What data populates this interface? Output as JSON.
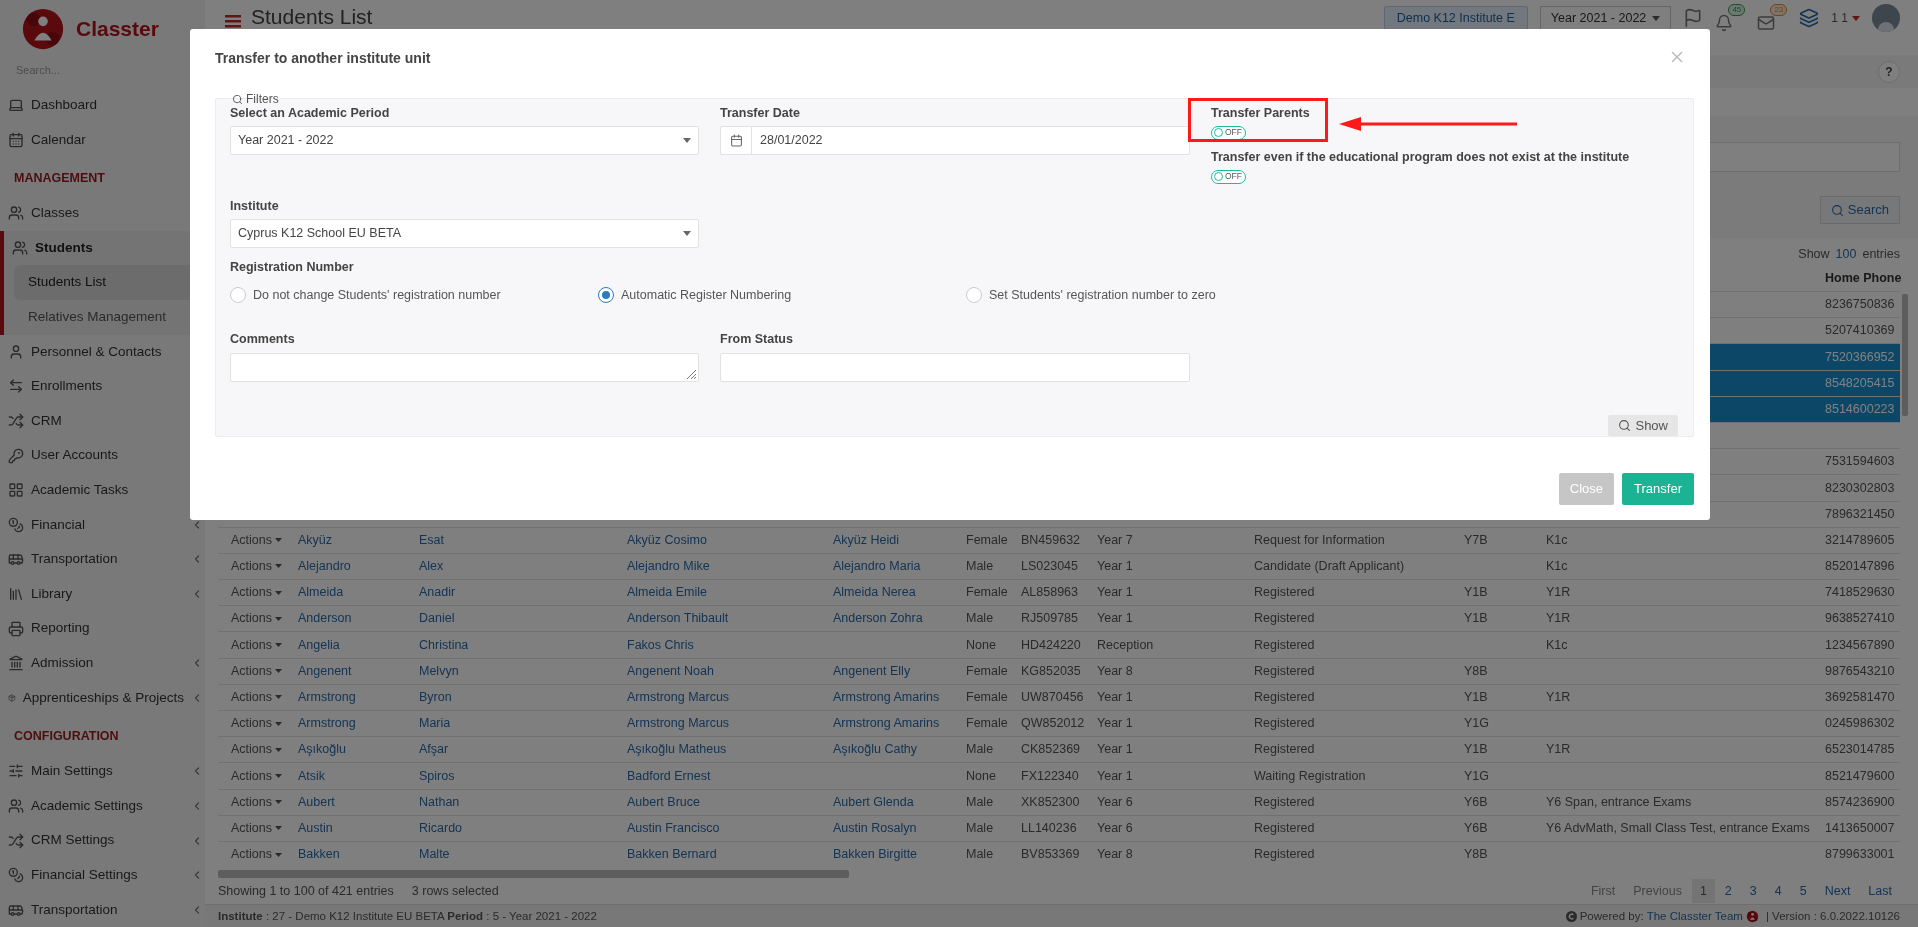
{
  "sidebar": {
    "logo": "Classter",
    "search": {
      "placeholder": "Search..."
    },
    "sections": [
      {
        "items": [
          {
            "label": "Dashboard",
            "selected": false
          },
          {
            "label": "Calendar",
            "selected": false
          }
        ]
      },
      {
        "title": "MANAGEMENT",
        "items": [
          {
            "label": "Classes",
            "selected": false
          },
          {
            "label": "Students",
            "selected": true,
            "children": [
              {
                "label": "Students List",
                "selected": true
              },
              {
                "label": "Relatives Management",
                "selected": false
              }
            ]
          },
          {
            "label": "Personnel & Contacts",
            "selected": false
          },
          {
            "label": "Enrollments",
            "selected": false
          },
          {
            "label": "CRM",
            "selected": false
          },
          {
            "label": "User Accounts",
            "selected": false
          },
          {
            "label": "Academic Tasks",
            "selected": false
          },
          {
            "label": "Financial",
            "selected": false,
            "submenu": true
          },
          {
            "label": "Transportation",
            "selected": false,
            "submenu": true
          },
          {
            "label": "Library",
            "selected": false,
            "submenu": true
          },
          {
            "label": "Reporting",
            "selected": false,
            "submenu": false
          },
          {
            "label": "Admission",
            "selected": false,
            "submenu": true
          },
          {
            "label": "Apprenticeships & Projects",
            "selected": false,
            "submenu": true
          }
        ]
      },
      {
        "title": "CONFIGURATION",
        "items": [
          {
            "label": "Main Settings",
            "selected": false,
            "submenu": true
          },
          {
            "label": "Academic Settings",
            "selected": false,
            "submenu": true
          },
          {
            "label": "CRM Settings",
            "selected": false,
            "submenu": true
          },
          {
            "label": "Financial Settings",
            "selected": false,
            "submenu": true
          },
          {
            "label": "Transportation",
            "selected": false,
            "submenu": true
          }
        ]
      }
    ]
  },
  "header": {
    "title": "Students List",
    "institute_button": "Demo K12 Institute E",
    "period_select": "Year 2021 - 2022",
    "notifications": "45",
    "messages": "23",
    "user": "1 1",
    "help": "?"
  },
  "filters": {
    "search_button": "Search"
  },
  "table": {
    "show": "Show",
    "page_size": "100",
    "entries": "entries",
    "home_phone_heading": "Home Phone",
    "rows": [
      {
        "selected": false,
        "home_phone": "8236750836"
      },
      {
        "selected": false,
        "home_phone": "5207410369"
      },
      {
        "selected": true,
        "home_phone": "7520366952"
      },
      {
        "selected": true,
        "home_phone": "8548205415"
      },
      {
        "selected": true,
        "home_phone": "8514600223"
      },
      {
        "selected": false
      },
      {
        "selected": false,
        "home_phone": "7531594603"
      },
      {
        "selected": false,
        "home_phone": "8230302803"
      },
      {
        "selected": false,
        "home_phone": "7896321450"
      },
      {
        "selected": false,
        "actions": "Actions",
        "column_2": "Akyüz",
        "column_3": "Esat",
        "column_4": "Akyüz Cosimo",
        "column_5": "Akyüz Heidi",
        "column_6": "Female",
        "column_7": "BN459632",
        "column_8": "Year 7",
        "column_9": "Request for Information",
        "column_10": "Y7B",
        "column_11": "K1c",
        "home_phone": "3214789605"
      },
      {
        "selected": false,
        "actions": "Actions",
        "column_2": "Alejandro",
        "column_3": "Alex",
        "column_4": "Alejandro Mike",
        "column_5": "Alejandro Maria",
        "column_6": "Male",
        "column_7": "LS023045",
        "column_8": "Year 1",
        "column_9": "Candidate (Draft Applicant)",
        "column_11": "K1c",
        "home_phone": "8520147896"
      },
      {
        "selected": false,
        "actions": "Actions",
        "column_2": "Almeida",
        "column_3": "Anadir",
        "column_4": "Almeida Emile",
        "column_5": "Almeida Nerea",
        "column_6": "Female",
        "column_7": "AL858963",
        "column_8": "Year 1",
        "column_9": "Registered",
        "column_10": "Y1B",
        "column_11": "Y1R",
        "home_phone": "7418529630"
      },
      {
        "selected": false,
        "actions": "Actions",
        "column_2": "Anderson",
        "column_3": "Daniel",
        "column_4": "Anderson Thibault",
        "column_5": "Anderson Zohra",
        "column_6": "Male",
        "column_7": "RJ509785",
        "column_8": "Year 1",
        "column_9": "Registered",
        "column_10": "Y1B",
        "column_11": "Y1R",
        "home_phone": "9638527410"
      },
      {
        "selected": false,
        "actions": "Actions",
        "column_2": "Angelia",
        "column_3": "Christina",
        "column_4": "Fakos Chris",
        "column_6": "None",
        "column_7": "HD424220",
        "column_8": "Reception",
        "column_9": "Registered",
        "column_11": "K1c",
        "home_phone": "1234567890"
      },
      {
        "selected": false,
        "actions": "Actions",
        "column_2": "Angenent",
        "column_3": "Melvyn",
        "column_4": "Angenent Noah",
        "column_5": "Angenent Elly",
        "column_6": "Female",
        "column_7": "KG852035",
        "column_8": "Year 8",
        "column_9": "Registered",
        "column_10": "Y8B",
        "home_phone": "9876543210"
      },
      {
        "selected": false,
        "actions": "Actions",
        "column_2": "Armstrong",
        "column_3": "Byron",
        "column_4": "Armstrong Marcus",
        "column_5": "Armstrong Amarins",
        "column_6": "Female",
        "column_7": "UW870456",
        "column_8": "Year 1",
        "column_9": "Registered",
        "column_10": "Y1B",
        "column_11": "Y1R",
        "home_phone": "3692581470"
      },
      {
        "selected": false,
        "actions": "Actions",
        "column_2": "Armstrong",
        "column_3": "Maria",
        "column_4": "Armstrong Marcus",
        "column_5": "Armstrong Amarins",
        "column_6": "Female",
        "column_7": "QW852012",
        "column_8": "Year 1",
        "column_9": "Registered",
        "column_10": "Y1G",
        "home_phone": "0245986302"
      },
      {
        "selected": false,
        "actions": "Actions",
        "column_2": "Aşıkoğlu",
        "column_3": "Afşar",
        "column_4": "Aşıkoğlu Matheus",
        "column_5": "Aşıkoğlu Cathy",
        "column_6": "Male",
        "column_7": "CK852369",
        "column_8": "Year 1",
        "column_9": "Registered",
        "column_10": "Y1B",
        "column_11": "Y1R",
        "home_phone": "6523014785"
      },
      {
        "selected": false,
        "actions": "Actions",
        "column_2": "Atsik",
        "column_3": "Spiros",
        "column_4": "Badford Ernest",
        "column_6": "None",
        "column_7": "FX122340",
        "column_8": "Year 1",
        "column_9": "Waiting Registration",
        "column_10": "Y1G",
        "home_phone": "8521479600"
      },
      {
        "selected": false,
        "actions": "Actions",
        "column_2": "Aubert",
        "column_3": "Nathan",
        "column_4": "Aubert Bruce",
        "column_5": "Aubert Glenda",
        "column_6": "Male",
        "column_7": "XK852300",
        "column_8": "Year 6",
        "column_9": "Registered",
        "column_10": "Y6B",
        "column_11": "Y6 Span, entrance Exams",
        "home_phone": "8574236900"
      },
      {
        "selected": false,
        "actions": "Actions",
        "column_2": "Austin",
        "column_3": "Ricardo",
        "column_4": "Austin Francisco",
        "column_5": "Austin Rosalyn",
        "column_6": "Male",
        "column_7": "LL140236",
        "column_8": "Year 6",
        "column_9": "Registered",
        "column_10": "Y6B",
        "column_11": "Y6 AdvMath, Small Class Test, entrance Exams",
        "home_phone": "1413650007"
      },
      {
        "selected": false,
        "actions": "Actions",
        "column_2": "Bakken",
        "column_3": "Malte",
        "column_4": "Bakken Bernard",
        "column_5": "Bakken Birgitte",
        "column_6": "Male",
        "column_7": "BV853369",
        "column_8": "Year 8",
        "column_9": "Registered",
        "column_10": "Y8B",
        "home_phone": "8799633001"
      }
    ]
  },
  "table_footer": {
    "info": "Showing 1 to 100 of 421 entries",
    "selection": "3 rows selected",
    "pagination": [
      {
        "label": "First",
        "selected": false,
        "disabled": true
      },
      {
        "label": "Previous",
        "selected": false,
        "disabled": true
      },
      {
        "label": "1",
        "selected": true,
        "disabled": false
      },
      {
        "label": "2",
        "selected": false,
        "disabled": false
      },
      {
        "label": "3",
        "selected": false,
        "disabled": false
      },
      {
        "label": "4",
        "selected": false,
        "disabled": false
      },
      {
        "label": "5",
        "selected": false,
        "disabled": false
      },
      {
        "label": "Next",
        "selected": false,
        "disabled": false
      },
      {
        "label": "Last",
        "selected": false,
        "disabled": false
      }
    ]
  },
  "footer": {
    "context": "**Institute** : 27 - Demo K12 Institute EU BETA **Period** : 5 - Year 2021 - 2022",
    "powered_by": "Powered by:",
    "team": "The Classter Team",
    "version": "| Version : 6.0.2022.10126"
  },
  "modal": {
    "title": "Transfer to another institute unit",
    "filters_legend": "Filters",
    "academic_period": {
      "label": "Select an Academic Period",
      "value": "Year 2021 - 2022"
    },
    "transfer_date": {
      "label": "Transfer Date",
      "value": "28/01/2022"
    },
    "toggles": [
      {
        "label": "Transfer Parents",
        "on": false,
        "text": "OFF",
        "highlighted": true
      },
      {
        "label": "Transfer even if the educational program does not exist at the institute",
        "on": false,
        "text": "OFF",
        "highlighted": false
      }
    ],
    "institute": {
      "label": "Institute",
      "value": "Cyprus K12 School EU BETA"
    },
    "registration_number": {
      "label": "Registration Number",
      "options": [
        {
          "label": "Do not change Students' registration number",
          "selected": false
        },
        {
          "label": "Automatic Register Numbering",
          "selected": true
        },
        {
          "label": "Set Students' registration number to zero",
          "selected": false
        }
      ]
    },
    "comments": {
      "label": "Comments"
    },
    "from_status": {
      "label": "From Status"
    },
    "show_button": "Show",
    "close_button": "Close",
    "transfer_button": "Transfer"
  }
}
